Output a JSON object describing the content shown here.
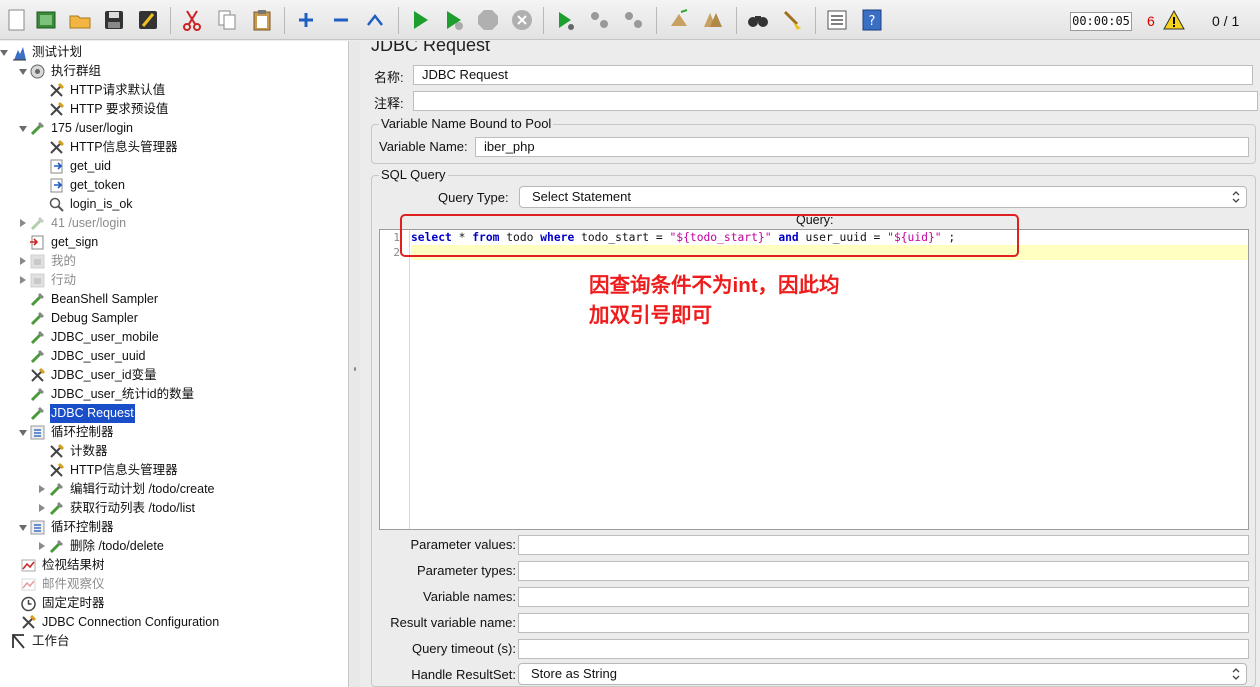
{
  "toolbar": {
    "buttons": [
      "new-icon",
      "templates-icon",
      "open-icon",
      "save-icon",
      "save-as-icon",
      "cut-icon",
      "copy-icon",
      "paste-icon",
      "expand-icon",
      "collapse-icon",
      "toggle-icon",
      "start-icon",
      "start-no-pause-icon",
      "stop-icon",
      "shutdown-icon",
      "remote-start-icon",
      "remote-stop-icon",
      "remote-shutdown-icon",
      "clear-icon",
      "clear-all-icon",
      "search-icon",
      "reset-search-icon",
      "function-helper-icon",
      "help-icon"
    ],
    "timer": "00:00:05",
    "error_count": "6",
    "thread_count": "0 / 1"
  },
  "tree": {
    "items": [
      {
        "label": "测试计划",
        "icon": "test-plan-icon",
        "disabled": false,
        "selected": false
      },
      {
        "label": "执行群组",
        "icon": "thread-group-icon",
        "disabled": false,
        "selected": false
      },
      {
        "label": "HTTP请求默认值",
        "icon": "config-icon",
        "disabled": false,
        "selected": false
      },
      {
        "label": "HTTP 要求预设值",
        "icon": "config-icon",
        "disabled": false,
        "selected": false
      },
      {
        "label": "175  /user/login",
        "icon": "sampler-icon",
        "disabled": false,
        "selected": false
      },
      {
        "label": "HTTP信息头管理器",
        "icon": "config-icon",
        "disabled": false,
        "selected": false
      },
      {
        "label": "get_uid",
        "icon": "extractor-icon",
        "disabled": false,
        "selected": false
      },
      {
        "label": "get_token",
        "icon": "extractor-icon",
        "disabled": false,
        "selected": false
      },
      {
        "label": "login_is_ok",
        "icon": "assertion-icon",
        "disabled": false,
        "selected": false
      },
      {
        "label": "41  /user/login",
        "icon": "sampler-icon",
        "disabled": true,
        "selected": false
      },
      {
        "label": "get_sign",
        "icon": "preprocessor-icon",
        "disabled": false,
        "selected": false
      },
      {
        "label": "我的",
        "icon": "transaction-icon",
        "disabled": true,
        "selected": false
      },
      {
        "label": "行动",
        "icon": "transaction-icon",
        "disabled": true,
        "selected": false
      },
      {
        "label": "BeanShell Sampler",
        "icon": "sampler-icon",
        "disabled": false,
        "selected": false
      },
      {
        "label": "Debug Sampler",
        "icon": "sampler-icon",
        "disabled": false,
        "selected": false
      },
      {
        "label": "JDBC_user_mobile",
        "icon": "sampler-icon",
        "disabled": false,
        "selected": false
      },
      {
        "label": "JDBC_user_uuid",
        "icon": "sampler-icon",
        "disabled": false,
        "selected": false
      },
      {
        "label": "JDBC_user_id变量",
        "icon": "config-icon",
        "disabled": false,
        "selected": false
      },
      {
        "label": "JDBC_user_统计id的数量",
        "icon": "sampler-icon",
        "disabled": false,
        "selected": false
      },
      {
        "label": "JDBC Request",
        "icon": "sampler-icon",
        "disabled": false,
        "selected": true
      },
      {
        "label": "循环控制器",
        "icon": "loop-controller-icon",
        "disabled": false,
        "selected": false
      },
      {
        "label": "计数器",
        "icon": "config-icon",
        "disabled": false,
        "selected": false
      },
      {
        "label": "HTTP信息头管理器",
        "icon": "config-icon",
        "disabled": false,
        "selected": false
      },
      {
        "label": "编辑行动计划 /todo/create",
        "icon": "sampler-icon",
        "disabled": false,
        "selected": false
      },
      {
        "label": "获取行动列表 /todo/list",
        "icon": "sampler-icon",
        "disabled": false,
        "selected": false
      },
      {
        "label": "循环控制器",
        "icon": "loop-controller-icon",
        "disabled": false,
        "selected": false
      },
      {
        "label": "删除 /todo/delete",
        "icon": "sampler-icon",
        "disabled": false,
        "selected": false
      },
      {
        "label": "检视结果树",
        "icon": "listener-icon",
        "disabled": false,
        "selected": false
      },
      {
        "label": "邮件观察仪",
        "icon": "listener-icon",
        "disabled": true,
        "selected": false
      },
      {
        "label": "固定定时器",
        "icon": "timer-icon",
        "disabled": false,
        "selected": false
      },
      {
        "label": "JDBC Connection Configuration",
        "icon": "config-icon",
        "disabled": false,
        "selected": false
      },
      {
        "label": "工作台",
        "icon": "workbench-icon",
        "disabled": false,
        "selected": false
      }
    ]
  },
  "panel": {
    "title": "JDBC Request",
    "name_label": "名称:",
    "name_value": "JDBC Request",
    "comment_label": "注释:",
    "comment_value": "",
    "pool_group_title": "Variable Name Bound to Pool",
    "variable_name_label": "Variable Name:",
    "variable_name_value": "iber_php",
    "sql_group_title": "SQL Query",
    "query_type_label": "Query Type:",
    "query_type_value": "Select Statement",
    "query_label": "Query:",
    "line_numbers": [
      "1",
      "2"
    ],
    "query_tokens": [
      {
        "t": "select",
        "k": "kw"
      },
      {
        "t": " * ",
        "k": ""
      },
      {
        "t": "from",
        "k": "kw"
      },
      {
        "t": " todo ",
        "k": ""
      },
      {
        "t": "where",
        "k": "kw"
      },
      {
        "t": " todo_start = ",
        "k": ""
      },
      {
        "t": "\"${todo_start}\"",
        "k": "str"
      },
      {
        "t": " ",
        "k": ""
      },
      {
        "t": "and",
        "k": "kw"
      },
      {
        "t": " user_uuid = ",
        "k": ""
      },
      {
        "t": "\"${uid}\"",
        "k": "str"
      },
      {
        "t": " ;",
        "k": ""
      }
    ],
    "annotation_lines": [
      "因查询条件不为int，因此均",
      "加双引号即可"
    ],
    "parameter_values_label": "Parameter values:",
    "parameter_types_label": "Parameter types:",
    "variable_names_label": "Variable names:",
    "result_variable_name_label": "Result variable name:",
    "query_timeout_label": "Query timeout (s):",
    "handle_resultset_label": "Handle ResultSet:",
    "handle_resultset_value": "Store as String"
  },
  "colors": {
    "selection": "#1a4ec8",
    "annotation": "#ee1c1c",
    "keyword": "#0000c8",
    "string": "#c000a0",
    "current_line": "#ffffbf"
  }
}
